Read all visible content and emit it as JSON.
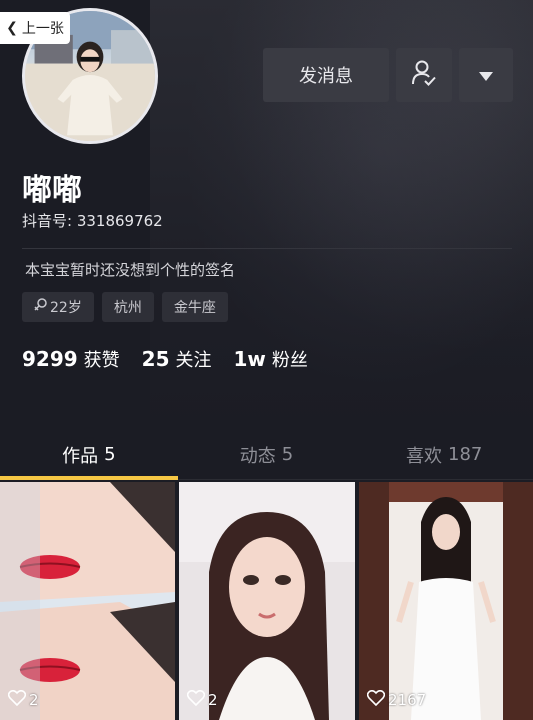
{
  "nav": {
    "back_label": "上一张"
  },
  "profile": {
    "name": "嘟嘟",
    "douyin_id": "抖音号: 331869762",
    "bio": "本宝宝暂时还没想到个性的签名",
    "tags": [
      {
        "icon": "female-icon",
        "label": "22岁"
      },
      {
        "label": "杭州"
      },
      {
        "label": "金牛座"
      }
    ],
    "stats": [
      {
        "value": "9299",
        "label": "获赞"
      },
      {
        "value": "25",
        "label": "关注"
      },
      {
        "value": "1w",
        "label": "粉丝"
      }
    ]
  },
  "actions": {
    "message_label": "发消息",
    "follow_icon": "user-check-icon",
    "more_icon": "caret-down-icon"
  },
  "tabs": [
    {
      "label": "作品",
      "count": "5",
      "active": true
    },
    {
      "label": "动态",
      "count": "5",
      "active": false
    },
    {
      "label": "喜欢",
      "count": "187",
      "active": false
    }
  ],
  "videos": [
    {
      "likes": "2"
    },
    {
      "likes": "2"
    },
    {
      "likes": "2167"
    }
  ],
  "colors": {
    "background": "#1b1c24",
    "tab_indicator": "#f6c744",
    "button_bg": "#3a3b43"
  }
}
